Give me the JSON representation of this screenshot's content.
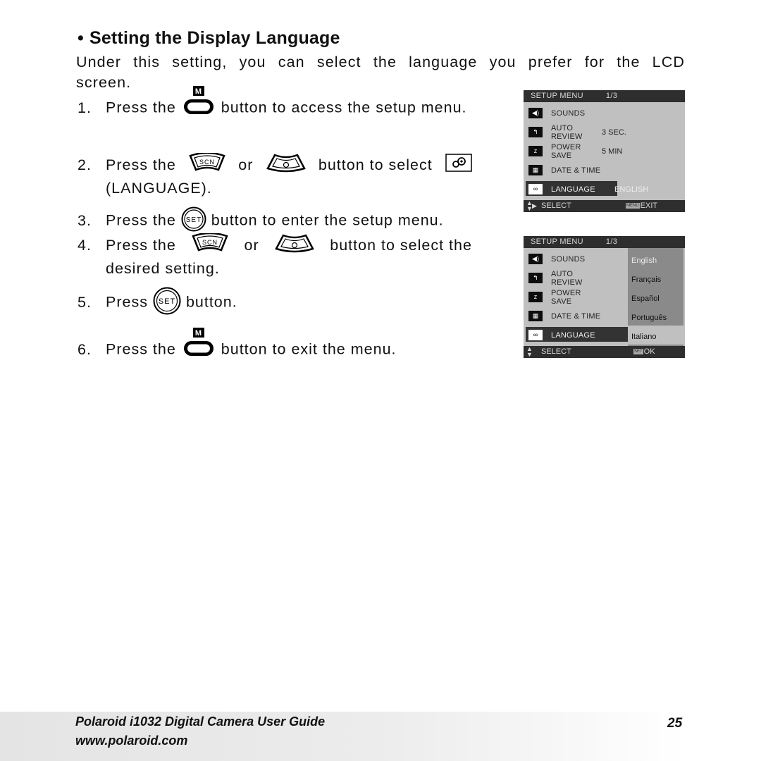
{
  "section": {
    "bullet": "•",
    "title": "Setting the Display Language",
    "intro": "Under this setting, you can select the language you prefer for the LCD screen."
  },
  "steps": [
    {
      "num": "1.",
      "pre": "Press the",
      "post": "button to access the setup menu.",
      "icon": "menu-button-icon",
      "icon_label": "M"
    },
    {
      "num": "2.",
      "pre": "Press the",
      "mid": "or",
      "post": "button to select",
      "cont": "(LANGUAGE).",
      "icons": [
        "scn-up-button-icon",
        "self-timer-down-button-icon",
        "language-icon"
      ],
      "icon_labels": [
        "SCN",
        "ꝺ"
      ]
    },
    {
      "num": "3.",
      "pre": "Press the",
      "post": "button to enter the setup menu.",
      "icon": "set-button-icon",
      "icon_label": "SET"
    },
    {
      "num": "4.",
      "pre": "Press the",
      "mid": "or",
      "post": "button to select the",
      "cont": "desired setting."
    },
    {
      "num": "5.",
      "pre": "Press",
      "post": "button.",
      "icon": "set-button-icon",
      "icon_label": "SET"
    },
    {
      "num": "6.",
      "pre": "Press the",
      "post": "button to exit the menu.",
      "icon": "menu-button-icon",
      "icon_label": "M"
    }
  ],
  "lcd1": {
    "header": "SETUP MENU",
    "page": "1/3",
    "items": [
      {
        "icon": "speaker-icon",
        "label": "SOUNDS",
        "value": ""
      },
      {
        "icon": "auto-review-icon",
        "label": "AUTO REVIEW",
        "value": "3 SEC."
      },
      {
        "icon": "power-save-icon",
        "label": "POWER SAVE",
        "value": "5 MIN"
      },
      {
        "icon": "date-time-icon",
        "label": "DATE & TIME",
        "value": ""
      },
      {
        "icon": "language-icon",
        "label": "LANGUAGE",
        "value": "ENGLISH",
        "selected": true
      }
    ],
    "footer_select": "SELECT",
    "footer_tag": "MENU",
    "footer_action": "EXIT"
  },
  "lcd2": {
    "header": "SETUP MENU",
    "page": "1/3",
    "items": [
      {
        "icon": "speaker-icon",
        "label": "SOUNDS"
      },
      {
        "icon": "auto-review-icon",
        "label": "AUTO REVIEW"
      },
      {
        "icon": "power-save-icon",
        "label": "POWER SAVE"
      },
      {
        "icon": "date-time-icon",
        "label": "DATE & TIME"
      },
      {
        "icon": "language-icon",
        "label": "LANGUAGE",
        "selected": true
      }
    ],
    "languages": [
      "English",
      "Français",
      "Español",
      "Português",
      "Italiano"
    ],
    "current_language": "English",
    "footer_select": "SELECT",
    "footer_tag": "SET",
    "footer_action": "OK"
  },
  "footer": {
    "guide_title": "Polaroid i1032 Digital Camera User Guide",
    "url": "www.polaroid.com",
    "page_number": "25"
  }
}
